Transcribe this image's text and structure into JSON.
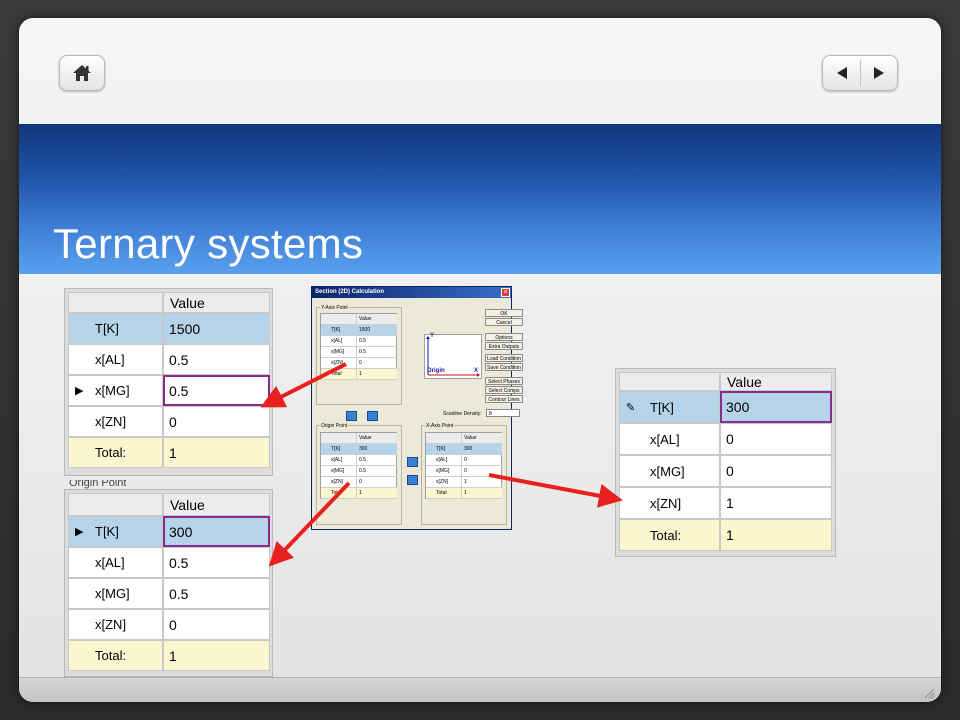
{
  "slide": {
    "title": "Ternary systems"
  },
  "nav": {
    "home_icon": "home-icon",
    "prev_icon": "triangle-left-icon",
    "next_icon": "triangle-right-icon"
  },
  "table_header": "Value",
  "table_top_left": {
    "rows": [
      {
        "label": "T[K]",
        "value": "1500",
        "style": "selected"
      },
      {
        "label": "x[AL]",
        "value": "0.5",
        "style": "white"
      },
      {
        "label": "x[MG]",
        "value": "0.5",
        "style": "editing",
        "marker": "▶"
      },
      {
        "label": "x[ZN]",
        "value": "0",
        "style": "white"
      },
      {
        "label": "Total:",
        "value": "1",
        "style": "total"
      }
    ]
  },
  "table_bottom_left": {
    "caption": "Origin Point",
    "rows": [
      {
        "label": "T[K]",
        "value": "300",
        "style": "selected-edit",
        "marker": "▶"
      },
      {
        "label": "x[AL]",
        "value": "0.5",
        "style": "white"
      },
      {
        "label": "x[MG]",
        "value": "0.5",
        "style": "white"
      },
      {
        "label": "x[ZN]",
        "value": "0",
        "style": "white"
      },
      {
        "label": "Total:",
        "value": "1",
        "style": "total"
      }
    ]
  },
  "table_right": {
    "rows": [
      {
        "label": "T[K]",
        "value": "300",
        "style": "selected-edit",
        "marker": "✎"
      },
      {
        "label": "x[AL]",
        "value": "0",
        "style": "white"
      },
      {
        "label": "x[MG]",
        "value": "0",
        "style": "white"
      },
      {
        "label": "x[ZN]",
        "value": "1",
        "style": "white"
      },
      {
        "label": "Total:",
        "value": "1",
        "style": "total"
      }
    ]
  },
  "dialog": {
    "title": "Section (2D) Calculation",
    "y_axis_group": "Y-Axis Point",
    "origin_group": "Origin Point",
    "x_axis_group": "X-Axis Point",
    "col_value": "Value",
    "y_rows": [
      [
        "T[K]",
        "1500"
      ],
      [
        "x[AL]",
        "0.5"
      ],
      [
        "x[MG]",
        "0.5"
      ],
      [
        "x[ZN]",
        "0"
      ],
      [
        "Total",
        "1"
      ]
    ],
    "origin_rows": [
      [
        "T[K]",
        "300"
      ],
      [
        "x[AL]",
        "0.5"
      ],
      [
        "x[MG]",
        "0.5"
      ],
      [
        "x[ZN]",
        "0"
      ],
      [
        "Total",
        "1"
      ]
    ],
    "x_rows": [
      [
        "T[K]",
        "300"
      ],
      [
        "x[AL]",
        "0"
      ],
      [
        "x[MG]",
        "0"
      ],
      [
        "x[ZN]",
        "1"
      ],
      [
        "Total",
        "1"
      ]
    ],
    "plot_y": "Y",
    "plot_x": "X",
    "plot_origin": "Origin",
    "scanline_label": "Scanline Density:",
    "scanline_value": "8",
    "buttons": [
      "OK",
      "Cancel",
      "Options",
      "Extra Outputs",
      "Load Condition",
      "Save Condition",
      "Select Phases",
      "Select Comps",
      "Contour Lines"
    ]
  },
  "colors": {
    "arrow": "#e8201f",
    "banner": "#2a62b8",
    "selected_row": "#b6d4e9",
    "total_row": "#fbf6d0",
    "edit_border": "#8a2a8a"
  }
}
